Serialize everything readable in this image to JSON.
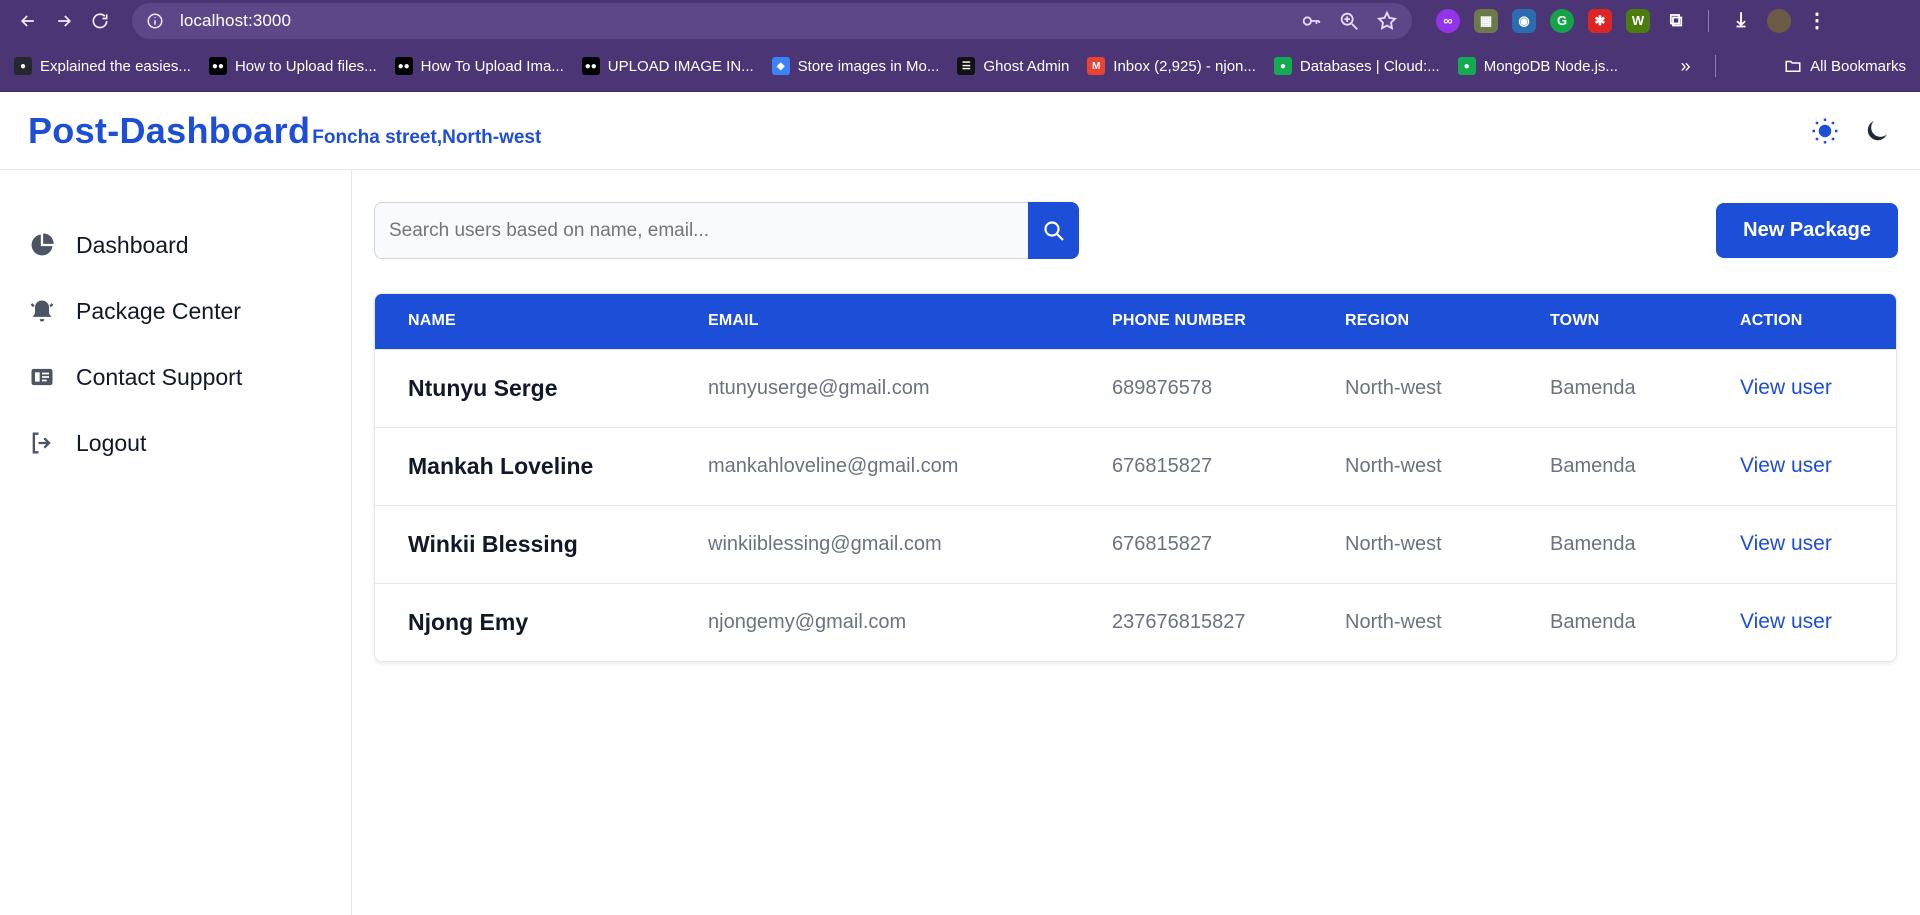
{
  "browser": {
    "url": "localhost:3000",
    "bookmarks": [
      {
        "label": "Explained the easies...",
        "icon": "github-icon",
        "color": "#24292f"
      },
      {
        "label": "How to Upload files...",
        "icon": "medium-icon",
        "color": "#000000"
      },
      {
        "label": "How To Upload Ima...",
        "icon": "medium-icon",
        "color": "#000000"
      },
      {
        "label": "UPLOAD IMAGE IN...",
        "icon": "medium-icon",
        "color": "#000000"
      },
      {
        "label": "Store images in Mo...",
        "icon": "diamond-icon",
        "color": "#3b82f6"
      },
      {
        "label": "Ghost Admin",
        "icon": "ghost-icon",
        "color": "#111111"
      },
      {
        "label": "Inbox (2,925) - njon...",
        "icon": "gmail-icon",
        "color": "#ea4335"
      },
      {
        "label": "Databases | Cloud:...",
        "icon": "mongodb-icon",
        "color": "#13aa52"
      },
      {
        "label": "MongoDB Node.js...",
        "icon": "mongodb-icon",
        "color": "#13aa52"
      }
    ],
    "all_bookmarks": "All Bookmarks"
  },
  "header": {
    "title": "Post-Dashboard",
    "subtitle": "Foncha street,North-west",
    "light_icon": "sun-icon",
    "dark_icon": "moon-icon"
  },
  "sidebar": {
    "items": [
      {
        "label": "Dashboard",
        "icon": "pie-chart-icon"
      },
      {
        "label": "Package Center",
        "icon": "bell-icon"
      },
      {
        "label": "Contact Support",
        "icon": "contact-card-icon"
      },
      {
        "label": "Logout",
        "icon": "logout-icon"
      }
    ]
  },
  "search": {
    "placeholder": "Search users based on name, email..."
  },
  "toolbar": {
    "new_package_label": "New Package"
  },
  "table": {
    "columns": [
      "NAME",
      "EMAIL",
      "PHONE NUMBER",
      "REGION",
      "TOWN",
      "ACTION"
    ],
    "rows": [
      [
        "Ntunyu Serge",
        "ntunyuserge@gmail.com",
        "689876578",
        "North-west",
        "Bamenda",
        "View user"
      ],
      [
        "Mankah Loveline",
        "mankahloveline@gmail.com",
        "676815827",
        "North-west",
        "Bamenda",
        "View user"
      ],
      [
        "Winkii Blessing",
        "winkiiblessing@gmail.com",
        "676815827",
        "North-west",
        "Bamenda",
        "View user"
      ],
      [
        "Njong Emy",
        "njongemy@gmail.com",
        "237676815827",
        "North-west",
        "Bamenda",
        "View user"
      ]
    ]
  },
  "colors": {
    "browser_frame": "#4c3575",
    "accent": "#1d4ed8"
  }
}
